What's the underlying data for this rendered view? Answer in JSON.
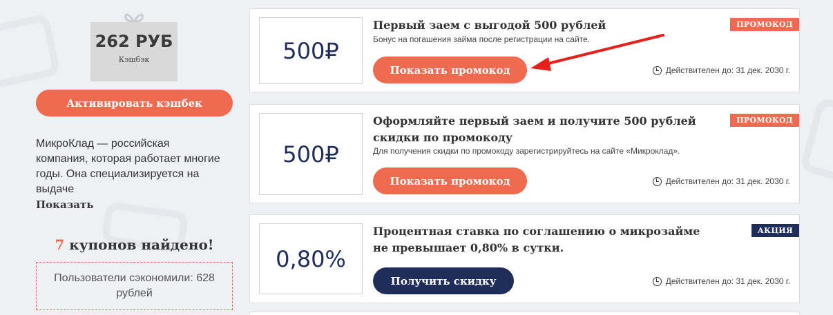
{
  "sidebar": {
    "cashback_amount": "262 РУБ",
    "cashback_label": "Кэшбэк",
    "activate_button": "Активировать кэшбек",
    "description": "МикроКлад — российская компания, которая работает многие годы. Она специализируется на выдаче",
    "show_more": "Показать",
    "found_count": "7",
    "found_text": "купонов найдено!",
    "saved_text": "Пользователи сэкономили: 628 рублей"
  },
  "coupons": [
    {
      "value": "500₽",
      "title": "Первый заем с выгодой 500 рублей",
      "subtitle": "Бонус на погашения займа после регистрации на сайте.",
      "badge": "ПРОМОКОД",
      "button": "Показать промокод",
      "validity": "Действителен до: 31 дек. 2030 г."
    },
    {
      "value": "500₽",
      "title": "Оформляйте первый заем и получите 500 рублей скидки по промокоду",
      "subtitle": "Для получения скидки по промокоду зарегистрируйтесь на сайте «Микроклад».",
      "badge": "ПРОМОКОД",
      "button": "Показать промокод",
      "validity": "Действителен до: 31 дек. 2030 г."
    },
    {
      "value": "0,80%",
      "title": "Процентная ставка по соглашению о микрозайме не превышает 0,80% в сутки.",
      "badge": "АКЦИЯ",
      "button": "Получить скидку",
      "validity": "Действителен до: 31 дек. 2030 г."
    }
  ],
  "colors": {
    "accent": "#ef6a4f",
    "navy": "#1f2d5a",
    "background": "#eef0f4",
    "arrow": "#e8201c"
  },
  "icons": [
    "gift-icon",
    "clock-icon",
    "arrow-annotation-icon"
  ]
}
